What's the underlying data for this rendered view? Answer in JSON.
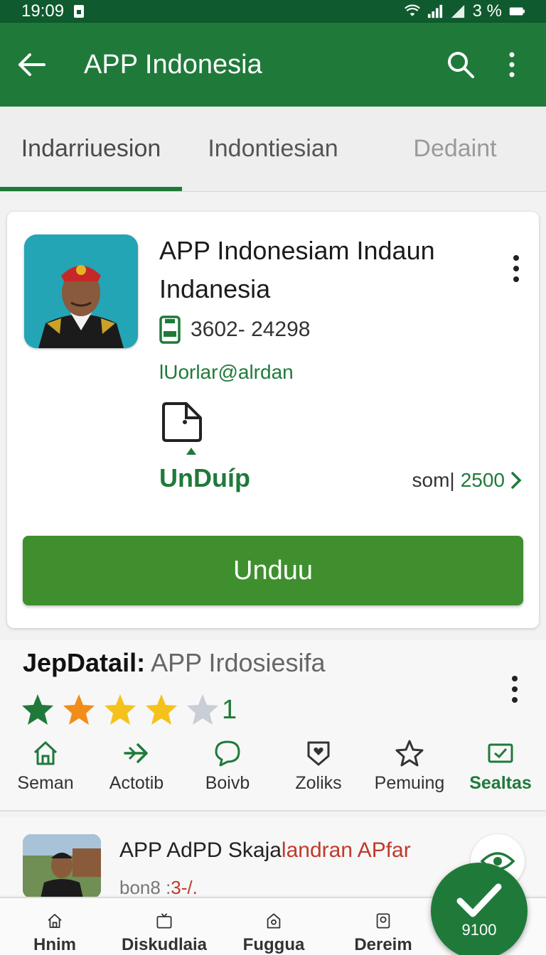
{
  "status_bar": {
    "time": "19:09",
    "battery": "3 %"
  },
  "app_bar": {
    "title": "APP Indonesia"
  },
  "tabs": [
    {
      "label": "Indarriuesion"
    },
    {
      "label": "Indontiesian"
    },
    {
      "label": "Dedaint"
    }
  ],
  "card": {
    "title": "APP Indonesiam Indaun Indanesia",
    "phone": "3602- 24298",
    "email": "lUorlar@alrdan",
    "unduh_label": "UnDuíp",
    "size_label": "som|",
    "size_value": "2500",
    "download_button": "Unduu"
  },
  "detail": {
    "label": "JepDatail:",
    "value": "APP Irdosiesifa",
    "rating": 4,
    "rating_count": "1",
    "actions": [
      {
        "label": "Seman",
        "icon": "home-icon"
      },
      {
        "label": "Actotib",
        "icon": "arrow-right-icon"
      },
      {
        "label": "Boivb",
        "icon": "chat-icon"
      },
      {
        "label": "Zoliks",
        "icon": "heart-shield-icon"
      },
      {
        "label": "Pemuing",
        "icon": "star-icon"
      },
      {
        "label": "Sealtas",
        "icon": "mail-icon"
      }
    ]
  },
  "list_item": {
    "title_part1": "APP AdPD Skaja",
    "title_part2": "landran APfar",
    "meta_part1": "bon8 :",
    "meta_part2": "3-/."
  },
  "bottom_nav": [
    {
      "label": "Hnim",
      "icon": "home-icon"
    },
    {
      "label": "Diskudlaia",
      "icon": "tv-icon"
    },
    {
      "label": "Fuggua",
      "icon": "location-icon"
    },
    {
      "label": "Dereim",
      "icon": "bookmark-icon"
    }
  ],
  "fab": {
    "label": "9100"
  },
  "colors": {
    "primary": "#1f7a3a",
    "status_bar": "#0f5a2e",
    "button": "#3f8f2e",
    "star_green": "#1f7a3a",
    "star_orange": "#f28c1a",
    "star_yellow": "#f5c21b",
    "star_empty": "#c9cdd6"
  }
}
